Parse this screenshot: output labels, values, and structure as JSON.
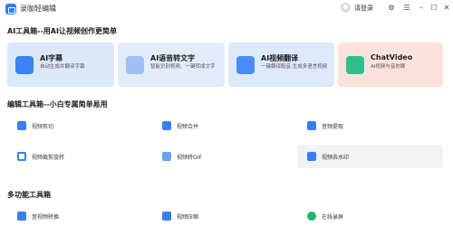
{
  "app": {
    "title": "录咖轻编辑",
    "login_label": "请登录"
  },
  "window_controls": {
    "settings": "⚙",
    "menu": "☰",
    "minimize": "–",
    "maximize": "☐",
    "close": "✕"
  },
  "sections": {
    "ai": "AI工具箱--用AI让视频创作更简单",
    "edit": "编辑工具箱--小白专属简单易用",
    "multi": "多功能工具箱"
  },
  "ai_cards": [
    {
      "title": "AI字幕",
      "desc": "自动生成并翻译字幕"
    },
    {
      "title": "AI语音转文字",
      "desc": "智能识别视频、一键转成文字"
    },
    {
      "title": "AI视频翻译",
      "desc": "一键翻译配音,生成多语言视频"
    },
    {
      "title": "ChatVideo",
      "desc": "AI视频与音你聊"
    }
  ],
  "edit_tools": [
    {
      "label": "视频剪切"
    },
    {
      "label": "视频合并"
    },
    {
      "label": "音频提取"
    },
    {
      "label": "视频裁剪旋转"
    },
    {
      "label": "视频转GIF"
    },
    {
      "label": "视频去水印"
    }
  ],
  "multi_tools": [
    {
      "label": "音视频转换"
    },
    {
      "label": "视频压缩"
    },
    {
      "label": "在线录屏"
    }
  ],
  "colors": {
    "accent": "#3d7df2",
    "green": "#26b36b",
    "chat_card": "#fbe3dc"
  }
}
